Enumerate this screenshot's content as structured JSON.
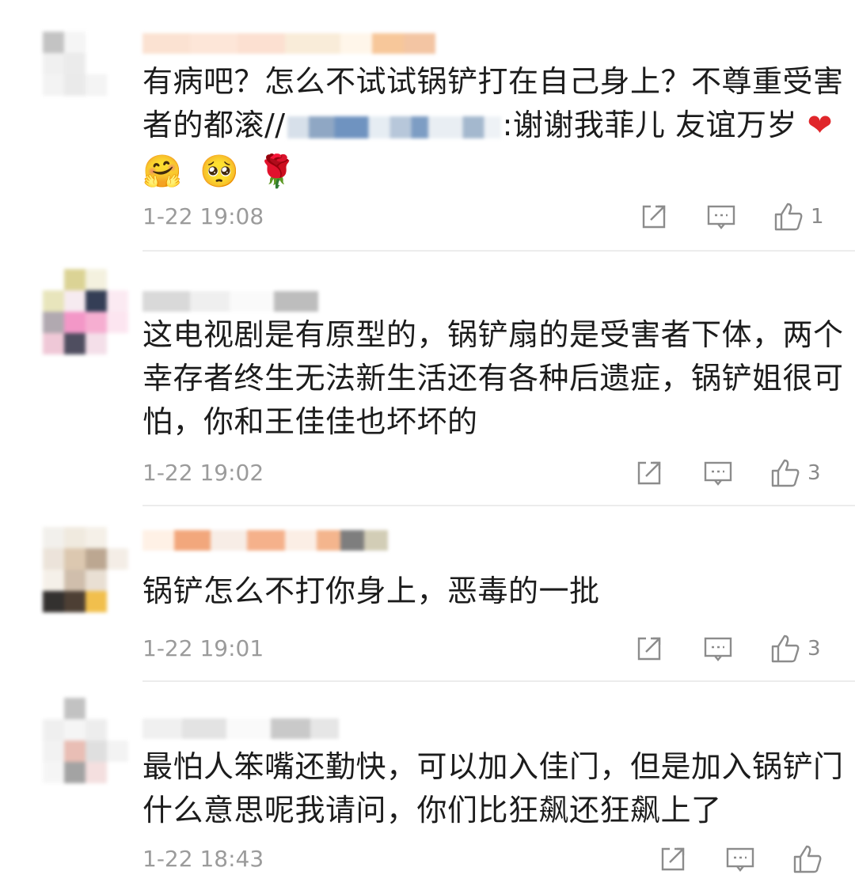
{
  "comments": [
    {
      "text_lines": [
        "有病吧？怎么不试试锅铲打在自己身上？不尊重受害",
        "者的都滚//"
      ],
      "text_line2_after_mosaic": ":谢谢我菲儿 友谊万岁",
      "emoji_heart": "❤",
      "emojis": [
        "🤗",
        "🥺",
        "🌹"
      ],
      "timestamp": "1-22 19:08",
      "likes": "1"
    },
    {
      "text_lines": [
        "这电视剧是有原型的，锅铲扇的是受害者下体，两个",
        "幸存者终生无法新生活还有各种后遗症，锅铲姐很可",
        "怕，你和王佳佳也坏坏的"
      ],
      "timestamp": "1-22 19:02",
      "likes": "3"
    },
    {
      "text_lines": [
        "锅铲怎么不打你身上，恶毒的一批"
      ],
      "timestamp": "1-22 19:01",
      "likes": "3"
    },
    {
      "text_lines": [
        "最怕人笨嘴还勤快，可以加入佳门，但是加入锅铲门",
        "什么意思呢我请问，你们比狂飙还狂飙上了"
      ],
      "timestamp": "1-22 18:43",
      "likes": ""
    }
  ],
  "icons": {
    "share": "share-icon",
    "comment": "comment-icon",
    "like": "thumbs-up-icon"
  }
}
